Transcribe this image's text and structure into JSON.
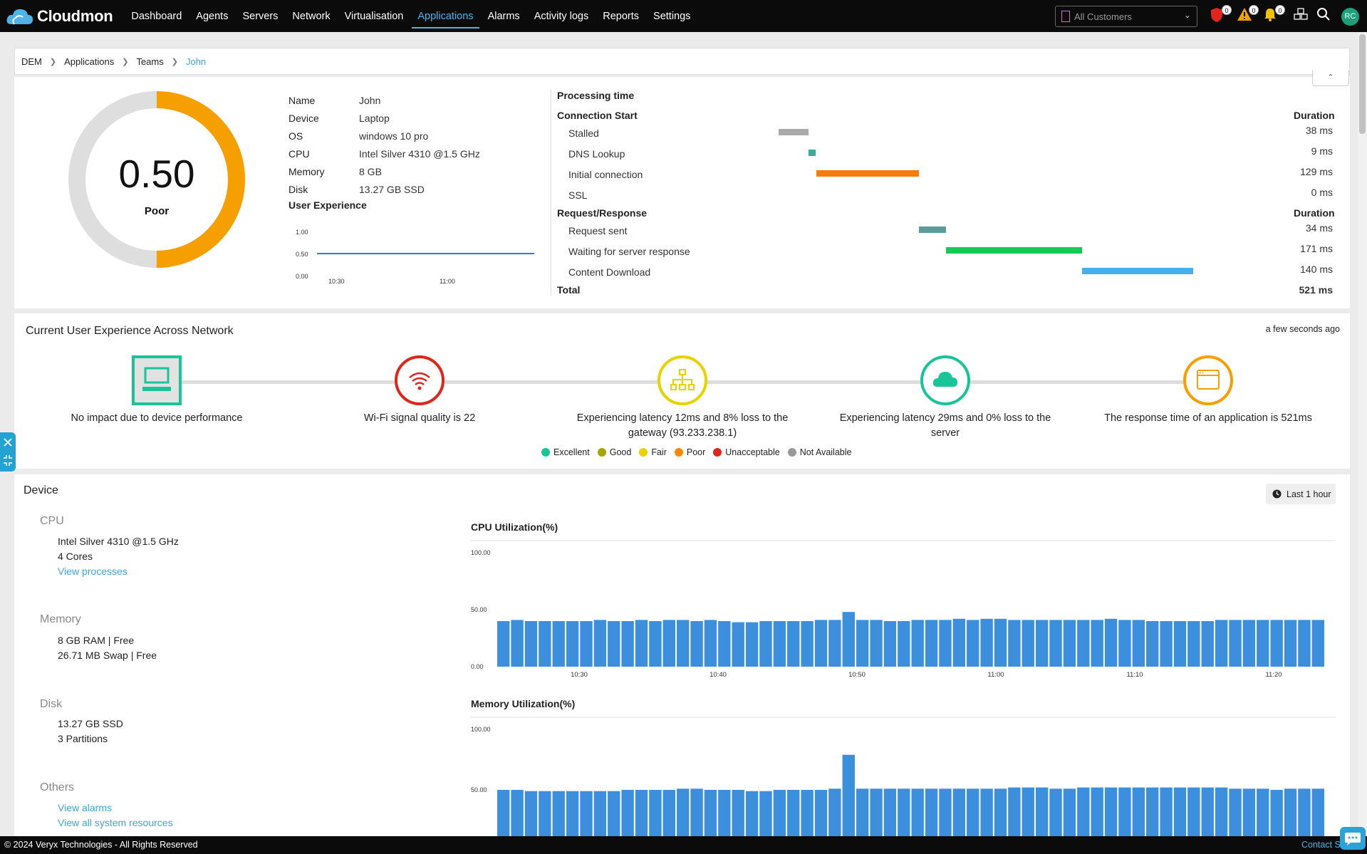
{
  "app": {
    "name": "Cloudmon"
  },
  "nav": [
    "Dashboard",
    "Agents",
    "Servers",
    "Network",
    "Virtualisation",
    "Applications",
    "Alarms",
    "Activity logs",
    "Reports",
    "Settings"
  ],
  "nav_active": "Applications",
  "customer_select": {
    "value": "All Customers"
  },
  "badges": {
    "security": "0",
    "warning": "0",
    "bell": "0"
  },
  "avatar": "RC",
  "breadcrumb": [
    "DEM",
    "Applications",
    "Teams",
    "John"
  ],
  "score": {
    "value": "0.50",
    "label": "Poor",
    "fraction": 0.5,
    "color": "#f5a000"
  },
  "info": [
    {
      "k": "Name",
      "v": "John"
    },
    {
      "k": "Device",
      "v": "Laptop"
    },
    {
      "k": "OS",
      "v": "windows 10 pro"
    },
    {
      "k": "CPU",
      "v": "Intel Silver 4310 @1.5 GHz"
    },
    {
      "k": "Memory",
      "v": "8 GB"
    },
    {
      "k": "Disk",
      "v": "13.27 GB  SSD"
    }
  ],
  "user_experience": {
    "title": "User Experience",
    "yticks": [
      "1.00",
      "0.50",
      "0.00"
    ],
    "xticks": [
      "10:30",
      "11:00"
    ],
    "value": 0.5
  },
  "processing": {
    "title": "Processing time",
    "duration_label": "Duration",
    "groups": [
      {
        "name": "Connection Start",
        "items": [
          {
            "label": "Stalled",
            "dur": "38 ms",
            "start": 0,
            "ms": 38,
            "color": "#aaaaaa"
          },
          {
            "label": "DNS Lookup",
            "dur": "9 ms",
            "start": 38,
            "ms": 9,
            "color": "#3aab9a"
          },
          {
            "label": "Initial connection",
            "dur": "129 ms",
            "start": 47,
            "ms": 129,
            "color": "#f77c0e"
          },
          {
            "label": "SSL",
            "dur": "0 ms",
            "start": 176,
            "ms": 0,
            "color": "#999999"
          }
        ]
      },
      {
        "name": "Request/Response",
        "items": [
          {
            "label": "Request sent",
            "dur": "34 ms",
            "start": 176,
            "ms": 34,
            "color": "#5e9a9a"
          },
          {
            "label": "Waiting for server response",
            "dur": "171 ms",
            "start": 210,
            "ms": 171,
            "color": "#14cc55"
          },
          {
            "label": "Content Download",
            "dur": "140 ms",
            "start": 381,
            "ms": 140,
            "color": "#45b0f0"
          }
        ]
      }
    ],
    "total_label": "Total",
    "total": "521 ms"
  },
  "network_ux": {
    "title": "Current User Experience Across Network",
    "ago": "a few seconds ago",
    "nodes": [
      {
        "text": "No impact due to device performance",
        "color": "#19c498",
        "icon": "laptop-icon"
      },
      {
        "text": "Wi-Fi signal quality is 22",
        "color": "#e0261b",
        "icon": "wifi-icon"
      },
      {
        "text": "Experiencing latency 12ms and 8% loss to the gateway (93.233.238.1)",
        "color": "#e8d200",
        "icon": "network-icon"
      },
      {
        "text": "Experiencing latency 29ms and 0% loss to the server",
        "color": "#19c498",
        "icon": "cloud-icon"
      },
      {
        "text": "The response time of an application is 521ms",
        "color": "#f5a000",
        "icon": "browser-icon"
      }
    ],
    "legend": [
      {
        "label": "Excellent",
        "color": "#19c498"
      },
      {
        "label": "Good",
        "color": "#a3a800"
      },
      {
        "label": "Fair",
        "color": "#e8d200"
      },
      {
        "label": "Poor",
        "color": "#f58a00"
      },
      {
        "label": "Unacceptable",
        "color": "#e0261b"
      },
      {
        "label": "Not Available",
        "color": "#999999"
      }
    ]
  },
  "device": {
    "title": "Device",
    "range": "Last 1 hour",
    "cpu": {
      "h": "CPU",
      "l1": "Intel Silver 4310 @1.5 GHz",
      "l2": "4 Cores",
      "link": "View processes"
    },
    "memory": {
      "h": "Memory",
      "l1": "8 GB RAM | Free",
      "l2": "26.71 MB Swap | Free"
    },
    "disk": {
      "h": "Disk",
      "l1": "13.27 GB SSD",
      "l2": "3 Partitions"
    },
    "others": {
      "h": "Others",
      "l1": "View alarms",
      "l2": "View all system resources"
    }
  },
  "chart_data": [
    {
      "type": "bar",
      "title": "CPU Utilization(%)",
      "ylim": [
        0,
        100
      ],
      "yticks": [
        "100.00",
        "50.00",
        "0.00"
      ],
      "xticks": [
        "10:30",
        "10:40",
        "10:50",
        "11:00",
        "11:10",
        "11:20"
      ],
      "values": [
        40,
        41,
        40,
        40,
        40,
        40,
        40,
        41,
        40,
        40,
        41,
        40,
        41,
        41,
        40,
        41,
        40,
        39,
        39,
        40,
        40,
        40,
        40,
        41,
        41,
        48,
        41,
        41,
        40,
        40,
        41,
        41,
        41,
        42,
        41,
        42,
        42,
        41,
        41,
        41,
        41,
        41,
        41,
        41,
        42,
        41,
        41,
        40,
        40,
        40,
        40,
        40,
        41,
        41,
        41,
        41,
        41,
        41,
        41,
        41
      ]
    },
    {
      "type": "bar",
      "title": "Memory Utilization(%)",
      "ylim": [
        0,
        100
      ],
      "yticks": [
        "100.00",
        "50.00"
      ],
      "values": [
        50,
        50,
        49,
        49,
        49,
        49,
        49,
        49,
        49,
        50,
        50,
        50,
        50,
        51,
        51,
        50,
        50,
        50,
        49,
        49,
        50,
        50,
        50,
        50,
        51,
        79,
        51,
        51,
        51,
        51,
        51,
        51,
        51,
        51,
        51,
        51,
        51,
        52,
        52,
        52,
        51,
        51,
        52,
        52,
        52,
        52,
        52,
        52,
        52,
        52,
        52,
        52,
        52,
        51,
        51,
        51,
        50,
        51,
        51,
        51
      ]
    }
  ],
  "footer": {
    "copyright": "© 2024 Veryx Technologies - All Rights Reserved",
    "contact": "Contact Su"
  }
}
